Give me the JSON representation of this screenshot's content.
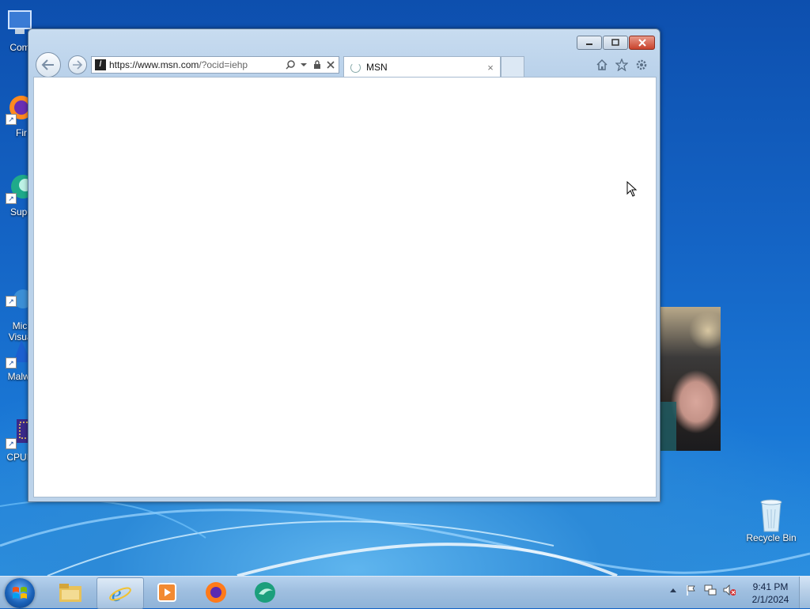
{
  "desktop": {
    "icons": [
      {
        "label": "Com",
        "icon": "computer-icon"
      },
      {
        "label": "Fir",
        "icon": "firefox-icon"
      },
      {
        "label": "Supe",
        "icon": "superdock-icon"
      },
      {
        "label": "Micr\nVisual",
        "icon": "visual-studio-icon"
      },
      {
        "label": "Malwa",
        "icon": "malwarebytes-icon"
      },
      {
        "label": "CPUID",
        "icon": "cpuid-icon"
      }
    ],
    "recycle_bin": {
      "label": "Recycle Bin",
      "icon": "recycle-bin-icon"
    }
  },
  "browser": {
    "address": {
      "scheme_host": "https://www.msn.com",
      "path": "/?ocid=iehp"
    },
    "tab": {
      "title": "MSN",
      "close": "×"
    },
    "toolbar": {
      "home": "home-icon",
      "favorites": "star-icon",
      "tools": "gear-icon"
    }
  },
  "taskbar": {
    "items": [
      "file-explorer-icon",
      "internet-explorer-icon",
      "media-player-icon",
      "firefox-icon",
      "browser-app-icon"
    ],
    "clock": {
      "time": "9:41 PM",
      "date": "2/1/2024"
    }
  },
  "colors": {
    "accent": "#1565c6",
    "close_button": "#c9422c"
  }
}
